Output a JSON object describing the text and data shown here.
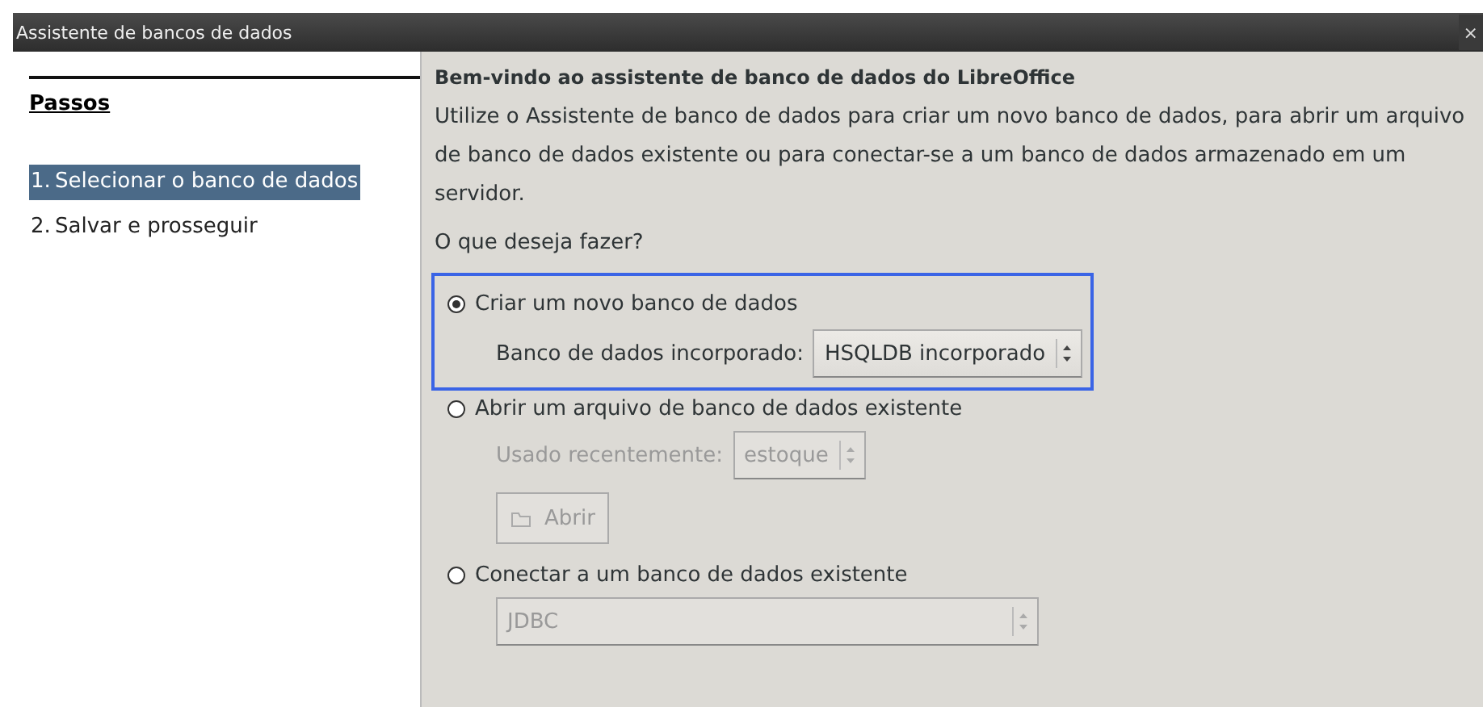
{
  "window": {
    "title": "Assistente de bancos de dados",
    "close": "×"
  },
  "steps": {
    "title": "Passos",
    "items": [
      {
        "number": "1.",
        "label": "Selecionar o banco de dados",
        "selected": true
      },
      {
        "number": "2.",
        "label": "Salvar e prosseguir",
        "selected": false
      }
    ]
  },
  "page": {
    "heading": "Bem-vindo ao assistente de banco de dados do LibreOffice",
    "intro": "Utilize o Assistente de banco de dados para criar um novo banco de dados, para abrir um arquivo de banco de dados existente ou para conectar-se a um banco de dados armazenado em um servidor.",
    "question": "O que deseja fazer?",
    "options": [
      {
        "label": "Criar um novo banco de dados",
        "selected": true,
        "focused": true,
        "controls": [
          {
            "kind": "combo",
            "label": "Banco de dados incorporado:",
            "value": "HSQLDB incorporado",
            "disabled": false,
            "wide": false
          }
        ]
      },
      {
        "label": "Abrir um arquivo de banco de dados existente",
        "selected": false,
        "focused": false,
        "controls": [
          {
            "kind": "combo",
            "label": "Usado recentemente:",
            "value": "estoque",
            "disabled": true,
            "wide": false
          },
          {
            "kind": "button",
            "label": "Abrir",
            "disabled": true
          }
        ]
      },
      {
        "label": "Conectar a um banco de dados existente",
        "selected": false,
        "focused": false,
        "controls": [
          {
            "kind": "combo",
            "value": "JDBC",
            "disabled": true,
            "wide": true
          }
        ]
      }
    ]
  }
}
